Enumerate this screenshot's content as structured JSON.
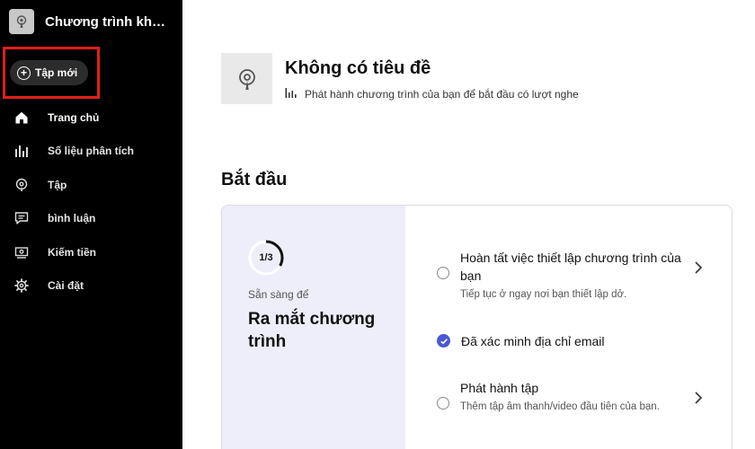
{
  "sidebar": {
    "show_title": "Chương trình khôn...",
    "new_episode_label": "Tập mới",
    "items": [
      {
        "label": "Trang chủ",
        "icon": "home-icon",
        "active": true
      },
      {
        "label": "Số liệu phân tích",
        "icon": "analytics-icon",
        "active": false
      },
      {
        "label": "Tập",
        "icon": "podcast-icon",
        "active": false
      },
      {
        "label": "bình luận",
        "icon": "comment-icon",
        "active": false
      },
      {
        "label": "Kiếm tiền",
        "icon": "money-icon",
        "active": false
      },
      {
        "label": "Cài đặt",
        "icon": "gear-icon",
        "active": false
      }
    ]
  },
  "header": {
    "title": "Không có tiêu đề",
    "subtitle": "Phát hành chương trình của bạn để bắt đầu có lượt nghe"
  },
  "get_started": {
    "title": "Bắt đầu",
    "progress_text": "1/3",
    "progress_fraction": 0.3333,
    "ready_label": "Sẵn sàng để",
    "launch_title": "Ra mắt chương trình",
    "tasks": [
      {
        "title": "Hoàn tất việc thiết lập chương trình của bạn",
        "desc": "Tiếp tục ở ngay nơi bạn thiết lập dở.",
        "done": false
      },
      {
        "title": "Đã xác minh địa chỉ email",
        "desc": "",
        "done": true
      },
      {
        "title": "Phát hành tập",
        "desc": "Thêm tập âm thanh/video đầu tiên của bạn.",
        "done": false
      }
    ]
  },
  "colors": {
    "sidebar_bg": "#000000",
    "highlight": "#e0201c",
    "accent": "#4a57d8",
    "card_left_bg": "#eeeefb"
  }
}
